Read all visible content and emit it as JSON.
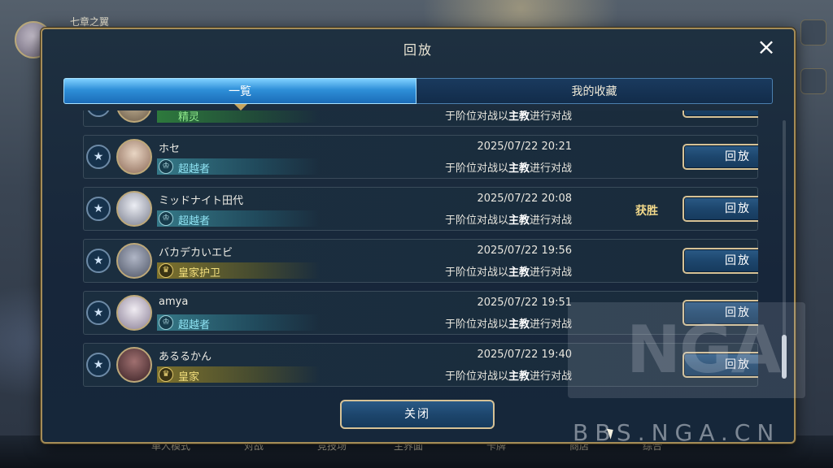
{
  "background": {
    "player_name": "七章之翼",
    "nav": [
      "单人模式",
      "对战",
      "竞技场",
      "主界面",
      "卡牌",
      "商店",
      "综合"
    ]
  },
  "dialog": {
    "title": "回放",
    "close_icon": "×",
    "tabs": [
      {
        "label": "一覧",
        "active": true
      },
      {
        "label": "我的收藏",
        "active": false
      }
    ],
    "partial_row": {
      "rank": "精灵",
      "desc_prefix": "于阶位对战以",
      "desc_class": "主教",
      "desc_suffix": "进行对战"
    },
    "rows": [
      {
        "name": "ホセ",
        "rank": "超越者",
        "rank_style": "teal",
        "date": "2025/07/22  20:21",
        "desc_prefix": "于阶位对战以",
        "desc_class": "主教",
        "desc_suffix": "进行对战",
        "result": "",
        "button": "回放",
        "avatar_color": "#c7a48e"
      },
      {
        "name": "ミッドナイト田代",
        "rank": "超越者",
        "rank_style": "teal",
        "date": "2025/07/22  20:08",
        "desc_prefix": "于阶位对战以",
        "desc_class": "主教",
        "desc_suffix": "进行对战",
        "result": "获胜",
        "button": "回放",
        "avatar_color": "#c9ccd8"
      },
      {
        "name": "バカデカいエビ",
        "rank": "皇家护卫",
        "rank_style": "gold",
        "date": "2025/07/22  19:56",
        "desc_prefix": "于阶位对战以",
        "desc_class": "主教",
        "desc_suffix": "进行对战",
        "result": "",
        "button": "回放",
        "avatar_color": "#8c93a6"
      },
      {
        "name": "amya",
        "rank": "超越者",
        "rank_style": "teal",
        "date": "2025/07/22  19:51",
        "desc_prefix": "于阶位对战以",
        "desc_class": "主教",
        "desc_suffix": "进行对战",
        "result": "",
        "button": "回放",
        "avatar_color": "#d6d2dc"
      },
      {
        "name": "あるるかん",
        "rank": "皇家",
        "rank_style": "gold",
        "date": "2025/07/22  19:40",
        "desc_prefix": "于阶位对战以",
        "desc_class": "主教",
        "desc_suffix": "进行对战",
        "result": "",
        "button": "回放",
        "avatar_color": "#5a3a3a"
      }
    ],
    "footer_button": "关闭"
  },
  "watermark": {
    "logo": "NGA",
    "url": "BBS.NGA.CN"
  }
}
